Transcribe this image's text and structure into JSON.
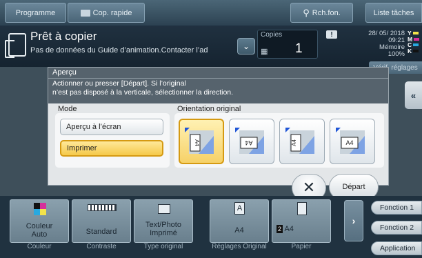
{
  "topbar": {
    "program_label": "Programme",
    "quickcopy_label": "Cop. rapide",
    "search_label": "Rch.fon.",
    "tasks_label": "Liste tâches"
  },
  "status": {
    "title": "Prêt à copier",
    "subtitle": "Pas de données du Guide d’animation.Contacter l’ad",
    "copies_label": "Copies",
    "copies_value": "1",
    "date": "28/ 05/ 2018",
    "time": "09:21",
    "memory_label": "Mémoire",
    "memory_value": "100%",
    "toner": [
      {
        "letter": "Y",
        "color": "#f2e34a"
      },
      {
        "letter": "M",
        "color": "#d6309b"
      },
      {
        "letter": "C",
        "color": "#29a9e0"
      },
      {
        "letter": "K",
        "color": "#111111"
      }
    ]
  },
  "right": {
    "verify_label": "Vérif. réglages"
  },
  "dialog": {
    "title": "Aperçu",
    "message_line1": "Actionner ou presser [Départ]. Si l’original",
    "message_line2": "n’est pas disposé à la verticale, sélectionner la direction.",
    "mode_label": "Mode",
    "mode_options": [
      "Aperçu à l’écran",
      "Imprimer"
    ],
    "mode_selected": "Imprimer",
    "orientation_label": "Orientation original",
    "orientation_options": [
      "A4 top",
      "A4 left",
      "A4 bottom",
      "A4 right"
    ],
    "orientation_selected": 0,
    "close_label": "✕",
    "start_label": "Départ"
  },
  "functions": [
    {
      "value": "Couleur\nAuto",
      "caption": "Couleur",
      "icon": "color-icon"
    },
    {
      "value": "Standard",
      "caption": "Contraste",
      "icon": "density-icon"
    },
    {
      "value": "Text/Photo\nImprimé",
      "caption": "Type original",
      "icon": "original-type-icon"
    },
    {
      "value": "A4",
      "caption": "Réglages\nOriginal",
      "icon": "original-settings-icon"
    },
    {
      "value": "A4",
      "caption": "Papier",
      "icon": "paper-icon",
      "tray": "2"
    }
  ],
  "sidebuttons": {
    "fn1": "Fonction 1",
    "fn2": "Fonction 2",
    "app": "Application"
  }
}
